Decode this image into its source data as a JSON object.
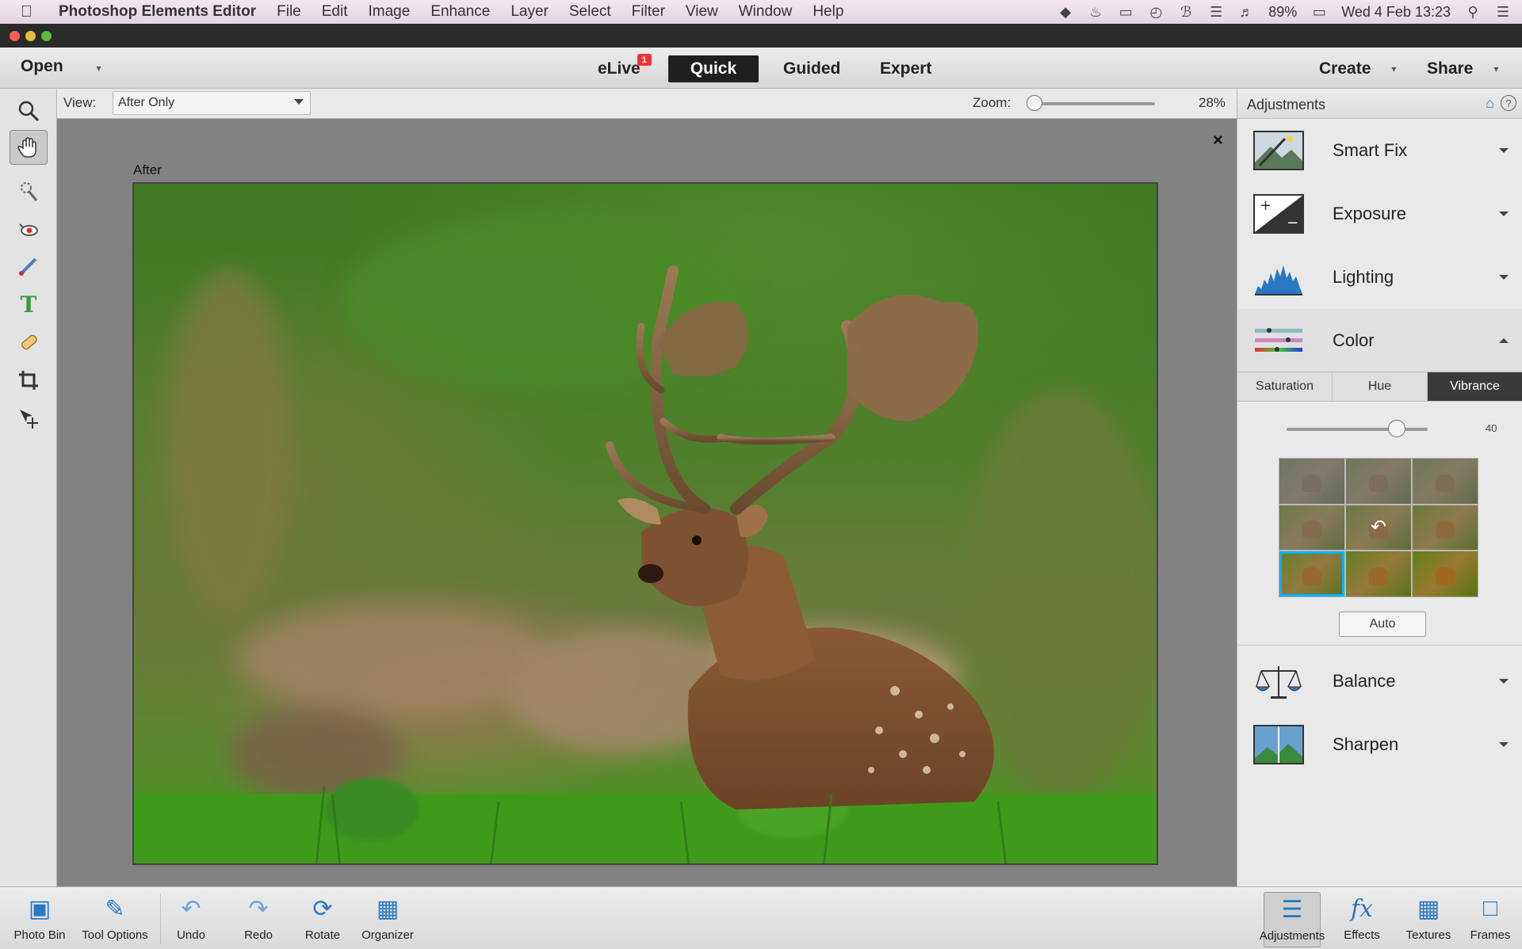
{
  "mac_menubar": {
    "app_name": "Photoshop Elements Editor",
    "menus": [
      "File",
      "Edit",
      "Image",
      "Enhance",
      "Layer",
      "Select",
      "Filter",
      "View",
      "Window",
      "Help"
    ],
    "battery": "89%",
    "datetime": "Wed 4 Feb  13:23"
  },
  "toolbar": {
    "open_label": "Open",
    "elive_label": "eLive",
    "elive_badge": "1",
    "modes": [
      "Quick",
      "Guided",
      "Expert"
    ],
    "active_mode": "Quick",
    "create_label": "Create",
    "share_label": "Share"
  },
  "options": {
    "view_label": "View:",
    "view_value": "After Only",
    "zoom_label": "Zoom:",
    "zoom_value": "28%",
    "zoom_level": 0.05
  },
  "canvas": {
    "after_label": "After",
    "close_glyph": "×"
  },
  "panel": {
    "title": "Adjustments",
    "items": [
      {
        "label": "Smart Fix",
        "icon": "smart-fix-icon"
      },
      {
        "label": "Exposure",
        "icon": "exposure-icon"
      },
      {
        "label": "Lighting",
        "icon": "lighting-histogram-icon"
      },
      {
        "label": "Color",
        "icon": "color-icon"
      },
      {
        "label": "Balance",
        "icon": "balance-icon"
      },
      {
        "label": "Sharpen",
        "icon": "sharpen-icon"
      }
    ],
    "color_tabs": [
      "Saturation",
      "Hue",
      "Vibrance"
    ],
    "active_tab": "Vibrance",
    "vibrance_value": "40",
    "vibrance_level": 0.78,
    "auto_label": "Auto"
  },
  "bottom": {
    "left": [
      {
        "label": "Photo Bin",
        "icon": "photo-bin-icon"
      },
      {
        "label": "Tool Options",
        "icon": "tool-options-icon"
      },
      {
        "label": "Undo",
        "icon": "undo-icon"
      },
      {
        "label": "Redo",
        "icon": "redo-icon"
      },
      {
        "label": "Rotate",
        "icon": "rotate-icon"
      },
      {
        "label": "Organizer",
        "icon": "organizer-icon"
      }
    ],
    "right": [
      {
        "label": "Adjustments",
        "icon": "adjustments-icon"
      },
      {
        "label": "Effects",
        "icon": "effects-fx-icon"
      },
      {
        "label": "Textures",
        "icon": "textures-icon"
      },
      {
        "label": "Frames",
        "icon": "frames-icon"
      }
    ]
  },
  "colors": {
    "accent_selection": "#25a7e8",
    "brand_blue": "#2a78c4",
    "active_mode_bg": "#1f1f1f"
  }
}
